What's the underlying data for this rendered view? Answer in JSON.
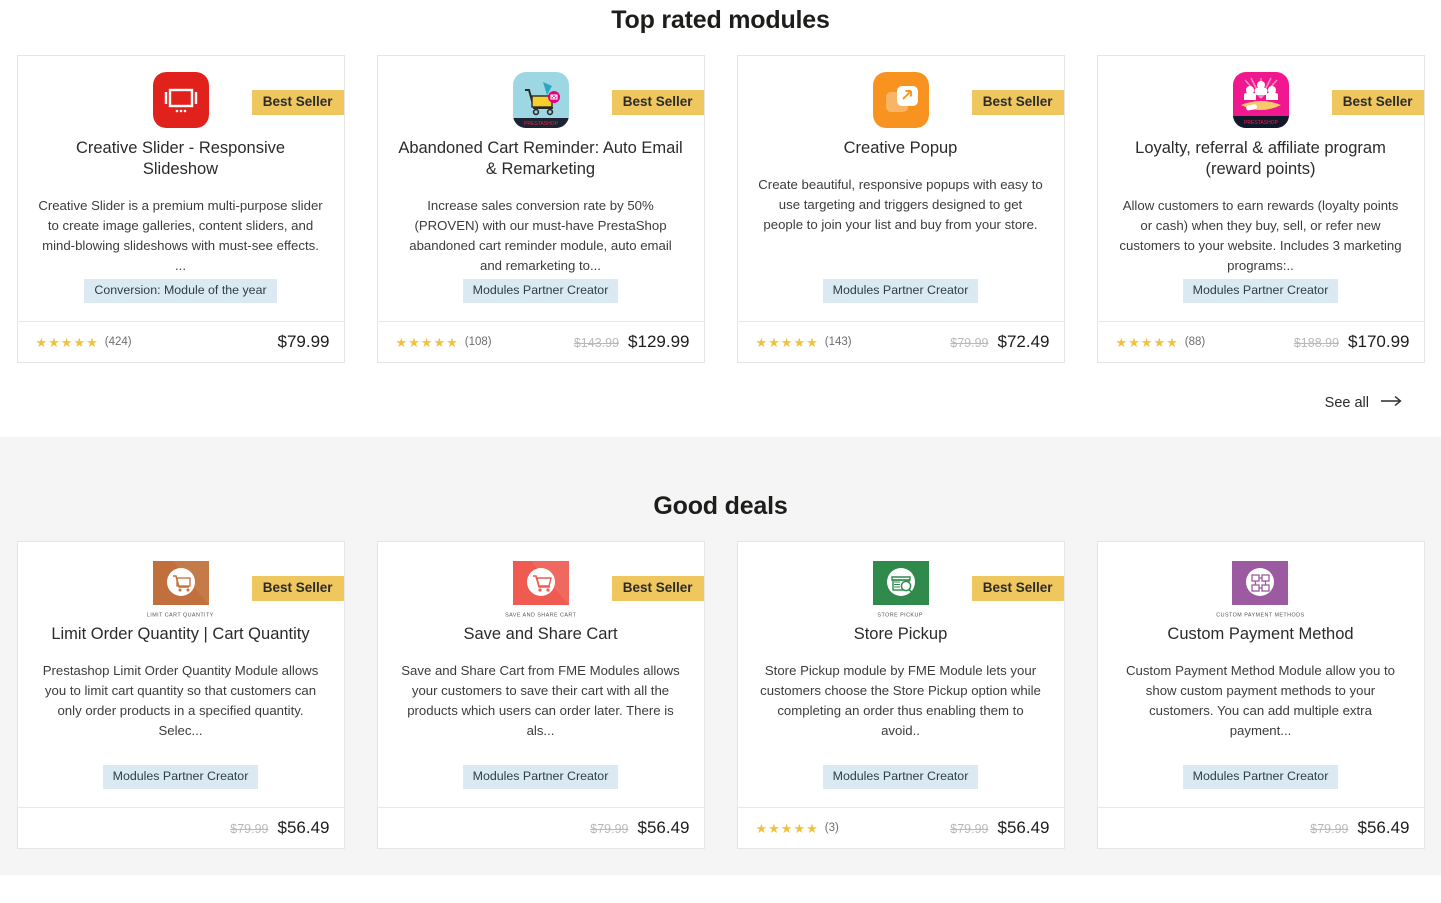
{
  "sections": [
    {
      "id": "top-rated",
      "title": "Top rated modules",
      "background": "#ffffff",
      "see_all": {
        "label": "See all",
        "icon": "arrow-right-icon"
      },
      "cards": [
        {
          "icon": "creative-slider-icon",
          "icon_bg": "#e1211c",
          "icon_shape": "rounded",
          "badge": "Best Seller",
          "title": "Creative Slider - Responsive Slideshow",
          "description": "Creative Slider is a premium multi-purpose slider to create image galleries, content sliders, and mind-blowing slideshows with must-see effects. ...",
          "tag": "Conversion: Module of the year",
          "stars": 5,
          "rating_count": "(424)",
          "price_old": "",
          "price_new": "$79.99"
        },
        {
          "icon": "abandoned-cart-icon",
          "icon_bg": "#9ed7e4",
          "icon_shape": "rounded",
          "badge": "Best Seller",
          "title": "Abandoned Cart Reminder: Auto Email & Remarketing",
          "description": "Increase sales conversion rate by 50% (PROVEN) with our must-have PrestaShop abandoned cart reminder module, auto email and remarketing to...",
          "tag": "Modules Partner Creator",
          "stars": 5,
          "rating_count": "(108)",
          "price_old": "$143.99",
          "price_new": "$129.99"
        },
        {
          "icon": "creative-popup-icon",
          "icon_bg": "#f7931e",
          "icon_shape": "rounded",
          "badge": "Best Seller",
          "title": "Creative Popup",
          "description": "Create beautiful, responsive popups with easy to use targeting and triggers designed to get people to join your list and buy from your store.",
          "tag": "Modules Partner Creator",
          "stars": 5,
          "rating_count": "(143)",
          "price_old": "$79.99",
          "price_new": "$72.49"
        },
        {
          "icon": "loyalty-program-icon",
          "icon_bg": "#f1178f",
          "icon_shape": "rounded",
          "badge": "Best Seller",
          "title": "Loyalty, referral & affiliate program (reward points)",
          "description": "Allow customers to earn rewards (loyalty points or cash) when they buy, sell, or refer new customers to your website. Includes 3 marketing programs:..",
          "tag": "Modules Partner Creator",
          "stars": 5,
          "rating_count": "(88)",
          "price_old": "$188.99",
          "price_new": "$170.99"
        }
      ]
    },
    {
      "id": "good-deals",
      "title": "Good deals",
      "background": "#f5f5f5",
      "see_all": null,
      "cards": [
        {
          "icon": "limit-order-quantity-icon",
          "icon_bg": "#c1703d",
          "icon_shape": "square",
          "icon_caption": "LIMIT CART QUANTITY",
          "badge": "Best Seller",
          "title": "Limit Order Quantity | Cart Quantity",
          "description": "Prestashop Limit Order Quantity Module allows you to limit cart quantity so that customers can only order products in a specified quantity. Selec...",
          "tag": "Modules Partner Creator",
          "stars": 0,
          "rating_count": "",
          "price_old": "$79.99",
          "price_new": "$56.49"
        },
        {
          "icon": "save-share-cart-icon",
          "icon_bg": "#ef5b51",
          "icon_shape": "square",
          "icon_caption": "SAVE AND SHARE CART",
          "badge": "Best Seller",
          "title": "Save and Share Cart",
          "description": "Save and Share Cart from FME Modules allows your customers to save their cart with all the products which users can order later. There is als...",
          "tag": "Modules Partner Creator",
          "stars": 0,
          "rating_count": "",
          "price_old": "$79.99",
          "price_new": "$56.49"
        },
        {
          "icon": "store-pickup-icon",
          "icon_bg": "#2f8a4c",
          "icon_shape": "square",
          "icon_caption": "STORE PICKUP",
          "badge": "Best Seller",
          "title": "Store Pickup",
          "description": "Store Pickup module by FME Module lets your customers choose the Store Pickup option while completing an order thus enabling them to avoid..",
          "tag": "Modules Partner Creator",
          "stars": 5,
          "rating_count": "(3)",
          "price_old": "$79.99",
          "price_new": "$56.49"
        },
        {
          "icon": "custom-payment-method-icon",
          "icon_bg": "#9c5aa0",
          "icon_shape": "square",
          "icon_caption": "CUSTOM PAYMENT METHODS",
          "badge": "",
          "title": "Custom Payment Method",
          "description": "Custom Payment Method Module allow you to show custom payment methods to your customers. You can add multiple extra payment...",
          "tag": "Modules Partner Creator",
          "stars": 0,
          "rating_count": "",
          "price_old": "$79.99",
          "price_new": "$56.49"
        }
      ]
    }
  ],
  "colors": {
    "badge_bg": "#efc75e",
    "tag_bg": "#dbeaf2",
    "star": "#f0c040",
    "price_old": "#b9b9b9",
    "section_gray": "#f5f5f5"
  }
}
